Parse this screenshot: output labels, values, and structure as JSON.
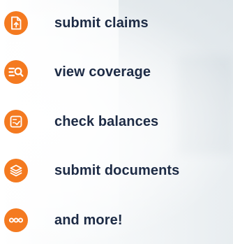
{
  "colors": {
    "accent": "#f47a20",
    "text": "#1d2b45"
  },
  "features": [
    {
      "label": "submit claims",
      "icon": "document-upload-icon"
    },
    {
      "label": "view coverage",
      "icon": "list-search-icon"
    },
    {
      "label": "check balances",
      "icon": "checklist-icon"
    },
    {
      "label": "submit documents",
      "icon": "layers-icon"
    },
    {
      "label": "and more!",
      "icon": "ellipsis-icon"
    }
  ]
}
